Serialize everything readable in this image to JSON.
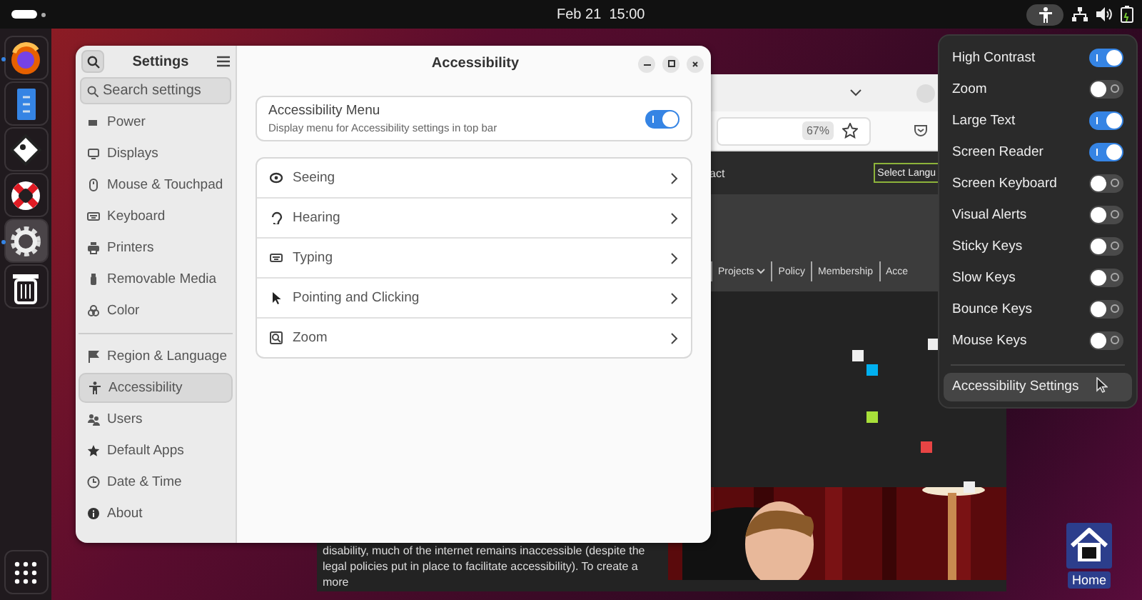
{
  "top_bar": {
    "clock": "Feb 21  15:00",
    "accessibility_active": true
  },
  "dock": {
    "apps": [
      {
        "kind": "globe",
        "running": true
      },
      {
        "kind": "document",
        "running": false
      },
      {
        "kind": "diamond",
        "running": false
      },
      {
        "kind": "lifebuoy",
        "running": false
      },
      {
        "kind": "gear",
        "running": true,
        "selected": true
      },
      {
        "kind": "trash",
        "running": false
      }
    ]
  },
  "settings": {
    "title": "Settings",
    "search": {
      "placeholder": "Search settings"
    },
    "sidebar": {
      "groups": [
        [
          {
            "label": "Power",
            "kind": "power",
            "selected": false
          },
          {
            "label": "Displays",
            "kind": "display",
            "selected": false
          },
          {
            "label": "Mouse & Touchpad",
            "kind": "mouse",
            "selected": false
          },
          {
            "label": "Keyboard",
            "kind": "keyboard",
            "selected": false
          },
          {
            "label": "Printers",
            "kind": "printer",
            "selected": false
          },
          {
            "label": "Removable Media",
            "kind": "usb",
            "selected": false
          },
          {
            "label": "Color",
            "kind": "color",
            "selected": false
          }
        ],
        [
          {
            "label": "Region & Language",
            "kind": "flag",
            "selected": false
          },
          {
            "label": "Accessibility",
            "kind": "person",
            "selected": true
          },
          {
            "label": "Users",
            "kind": "users",
            "selected": false
          },
          {
            "label": "Default Apps",
            "kind": "star",
            "selected": false
          },
          {
            "label": "Date & Time",
            "kind": "clock",
            "selected": false
          },
          {
            "label": "About",
            "kind": "info",
            "selected": false
          }
        ]
      ]
    },
    "page": {
      "title": "Accessibility",
      "menu_card": {
        "title": "Accessibility Menu",
        "description": "Display menu for Accessibility settings in top bar",
        "on": true
      },
      "rows": [
        {
          "label": "Seeing",
          "kind": "eye"
        },
        {
          "label": "Hearing",
          "kind": "ear"
        },
        {
          "label": "Typing",
          "kind": "keyboard"
        },
        {
          "label": "Pointing and Clicking",
          "kind": "pointer"
        },
        {
          "label": "Zoom",
          "kind": "zoom"
        }
      ]
    }
  },
  "browser": {
    "zoom": "67%",
    "nav_text": "act",
    "language_button": "Select Langu",
    "nav_items": [
      {
        "label": "Projects",
        "dropdown": true
      },
      {
        "label": "Policy",
        "dropdown": false
      },
      {
        "label": "Membership",
        "dropdown": false
      },
      {
        "label": "Acce",
        "dropdown": false
      }
    ],
    "paragraph": "disability, much of the internet remains inaccessible (despite the legal policies put in place to facilitate accessibility). To create a more"
  },
  "accessibility_menu": {
    "toggles": [
      {
        "label": "High Contrast",
        "on": true
      },
      {
        "label": "Zoom",
        "on": false
      },
      {
        "label": "Large Text",
        "on": true
      },
      {
        "label": "Screen Reader",
        "on": true
      },
      {
        "label": "Screen Keyboard",
        "on": false
      },
      {
        "label": "Visual Alerts",
        "on": false
      },
      {
        "label": "Sticky Keys",
        "on": false
      },
      {
        "label": "Slow Keys",
        "on": false
      },
      {
        "label": "Bounce Keys",
        "on": false
      },
      {
        "label": "Mouse Keys",
        "on": false
      }
    ],
    "settings_button": "Accessibility Settings"
  },
  "desktop_icons": [
    {
      "label": "Home"
    }
  ]
}
